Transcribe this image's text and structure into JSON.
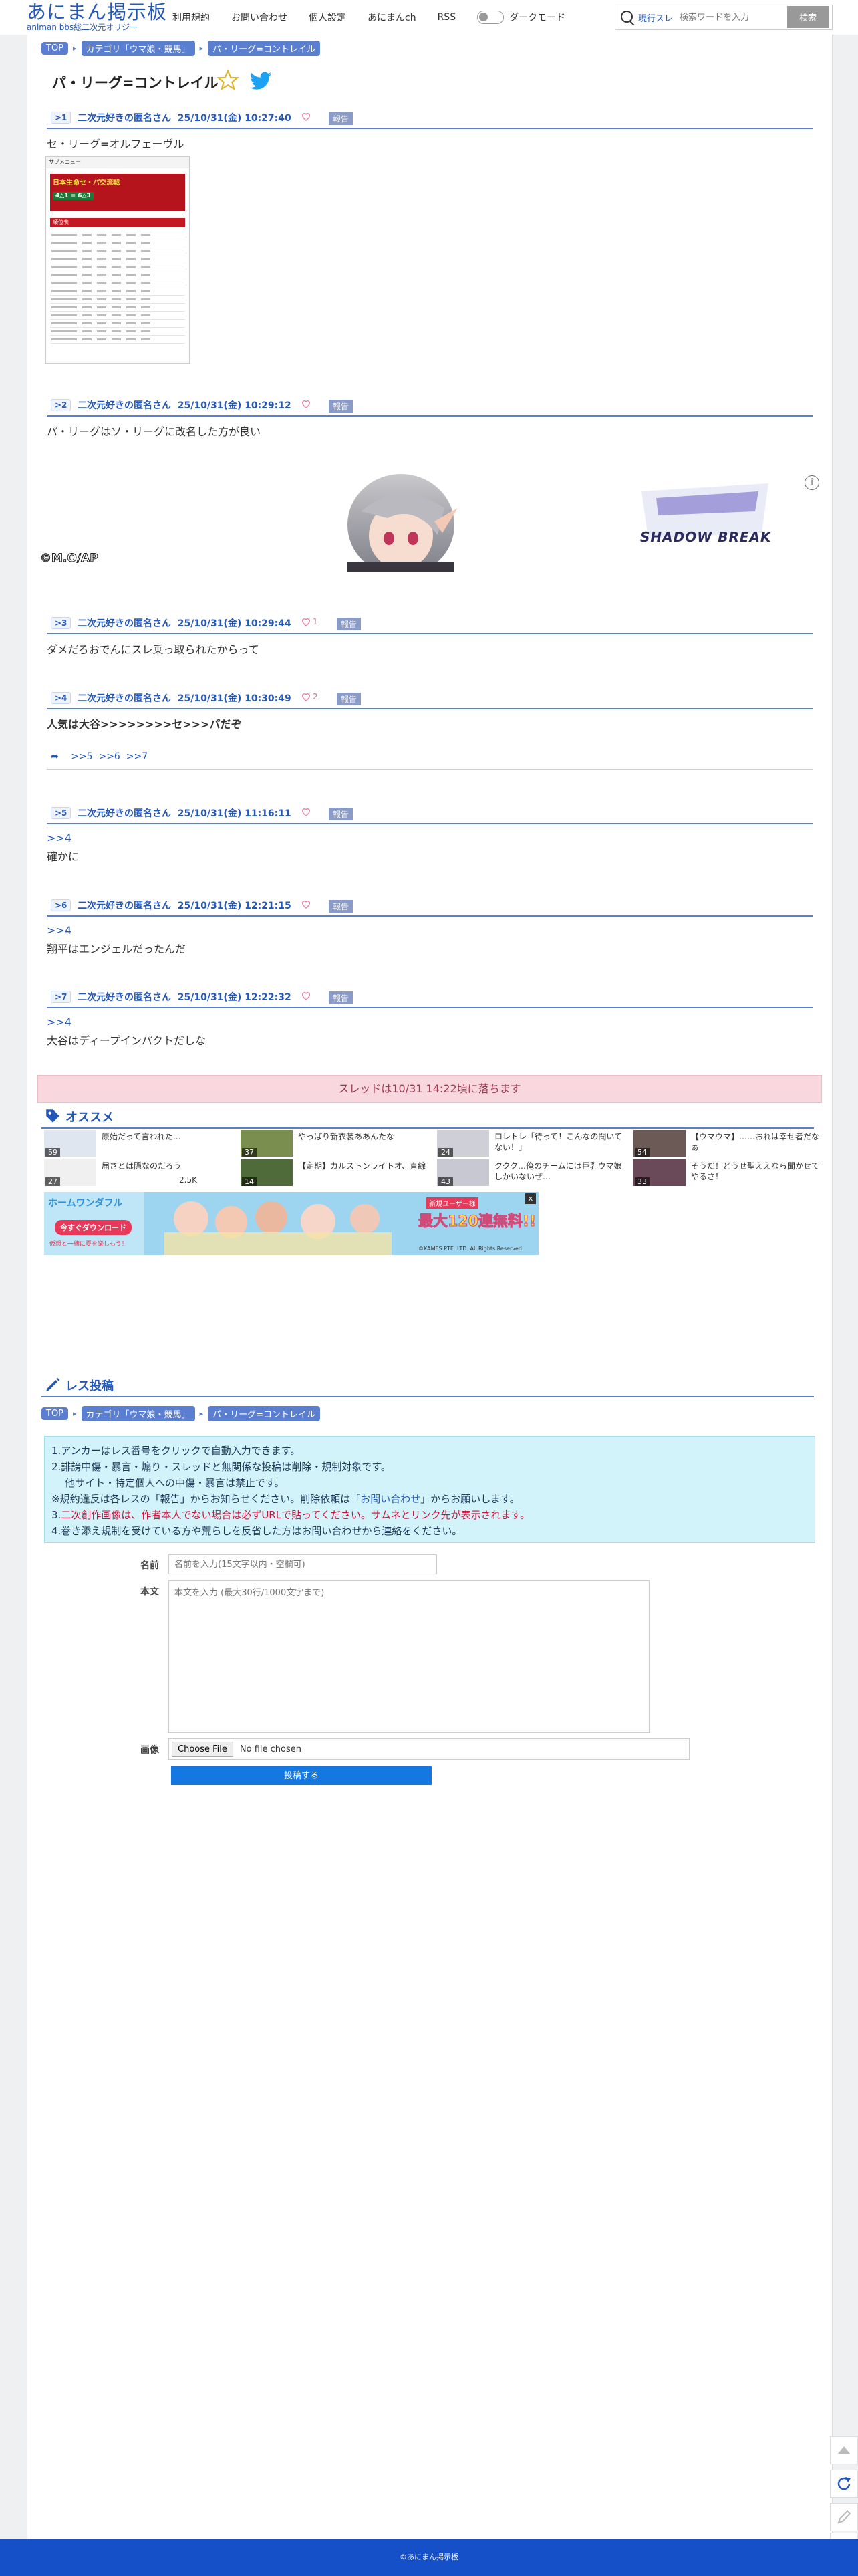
{
  "header": {
    "logo_main": "あにまん掲示板",
    "logo_sub": "animan bbs総二次元オリジー",
    "nav": [
      "利用規約",
      "お問い合わせ",
      "個人設定",
      "あにまんch",
      "RSS"
    ],
    "dark_mode_label": "ダークモード",
    "search_scope": "現行スレ",
    "search_placeholder": "検索ワードを入力",
    "search_button": "検索"
  },
  "breadcrumb": [
    "TOP",
    "カテゴリ「ウマ娘・競馬」",
    "パ・リーグ=コントレイル"
  ],
  "thread": {
    "title": "パ・リーグ=コントレイル",
    "posts": [
      {
        "num": ">1",
        "author": "二次元好きの匿名さん",
        "date": "25/10/31(金) 10:27:40",
        "likes": "",
        "body": "セ・リーグ=オルフェーヴル"
      },
      {
        "num": ">2",
        "author": "二次元好きの匿名さん",
        "date": "25/10/31(金) 10:29:12",
        "likes": "",
        "body": "パ・リーグはソ・リーグに改名した方が良い"
      },
      {
        "num": ">3",
        "author": "二次元好きの匿名さん",
        "date": "25/10/31(金) 10:29:44",
        "likes": "1",
        "body": "ダメだろおでんにスレ乗っ取られたからって"
      },
      {
        "num": ">4",
        "author": "二次元好きの匿名さん",
        "date": "25/10/31(金) 10:30:49",
        "likes": "2",
        "body": "人気は大谷>>>>>>>>セ>>>パだぞ"
      },
      {
        "num": ">5",
        "author": "二次元好きの匿名さん",
        "date": "25/10/31(金) 11:16:11",
        "likes": "",
        "anchor": ">>4",
        "body": "確かに"
      },
      {
        "num": ">6",
        "author": "二次元好きの匿名さん",
        "date": "25/10/31(金) 12:21:15",
        "likes": "",
        "anchor": ">>4",
        "body": "翔平はエンジェルだったんだ"
      },
      {
        "num": ">7",
        "author": "二次元好きの匿名さん",
        "date": "25/10/31(金) 12:22:32",
        "likes": "",
        "anchor": ">>4",
        "body": "大谷はディープインパクトだしな"
      }
    ],
    "report_label": "報告",
    "replies_to_4": [
      ">>5",
      ">>6",
      ">>7"
    ],
    "end_notice": "スレッドは10/31 14:22頃に落ちます"
  },
  "ad": {
    "copyright": "©M.O/AP",
    "logo_text": "SHADOW BREAK",
    "info": "i"
  },
  "recommend": {
    "heading": "オススメ",
    "items": [
      {
        "title": "原始だって言われた…",
        "count": "59"
      },
      {
        "title": "やっぱり新衣装ああんたな",
        "count": "37"
      },
      {
        "title": "ロレトレ「待って！こんなの聞いてない！」",
        "count": "24"
      },
      {
        "title": "【ウマウマ】……おれは幸せ者だなぁ",
        "count": "54"
      },
      {
        "title": "届さとは隠なのだろう",
        "count": "27",
        "extra": "2.5K"
      },
      {
        "title": "【定期】カルストンライトオ、直線",
        "count": "14"
      },
      {
        "title": "ククク…俺のチームには巨乳ウマ娘しかいないぜ…",
        "count": "43"
      },
      {
        "title": "そうだ！どうせ聖ええなら聞かせてやるさ！",
        "count": "33"
      }
    ]
  },
  "ad2": {
    "brand": "ホームワンダフル",
    "cta": "今すぐダウンロード",
    "sub": "仮想と一緒に夏を楽しもう！",
    "promo": "最大120連無料!!",
    "promo_sub": "新規ユーザー様",
    "copyright": "©KAMES PTE. LTD. All Rights Reserved.",
    "close": "x"
  },
  "post_form": {
    "heading": "レス投稿",
    "rules": {
      "r1": "1.アンカーはレス番号をクリックで自動入力できます。",
      "r2": "2.誹謗中傷・暴言・煽り・スレッドと無関係な投稿は削除・規制対象です。",
      "r2b": "他サイト・特定個人への中傷・暴言は禁止です。",
      "r2c_a": "※規約違反は各レスの「報告」からお知らせください。削除依頼は「",
      "r2c_link": "お問い合わせ",
      "r2c_b": "」からお願いします。",
      "r3_a": "3.",
      "r3_red": "二次創作画像は、作者本人でない場合は必ずURLで貼ってください。サムネとリンク先が表示されます。",
      "r4": "4.巻き添え規制を受けている方や荒らしを反省した方はお問い合わせから連絡をください。"
    },
    "name_label": "名前",
    "name_placeholder": "名前を入力(15文字以内・空欄可)",
    "body_label": "本文",
    "body_placeholder": "本文を入力 (最大30行/1000文字まで)",
    "image_label": "画像",
    "file_button": "Choose File",
    "file_status": "No file chosen",
    "submit": "投稿する"
  },
  "image_mock": {
    "menu": "サブメニュー",
    "banner": "日本生命セ・パ交流戦",
    "score": "4△1 = 6△3",
    "section": "順位表"
  },
  "footer": {
    "copyright": "©あにまん掲示板"
  },
  "colors": {
    "brand": "#2458b8",
    "accent": "#5b7fd0",
    "notice_bg": "#f8d7de",
    "rules_bg": "#d2f3f9",
    "submit": "#1478e0",
    "footer": "#1650c8"
  }
}
